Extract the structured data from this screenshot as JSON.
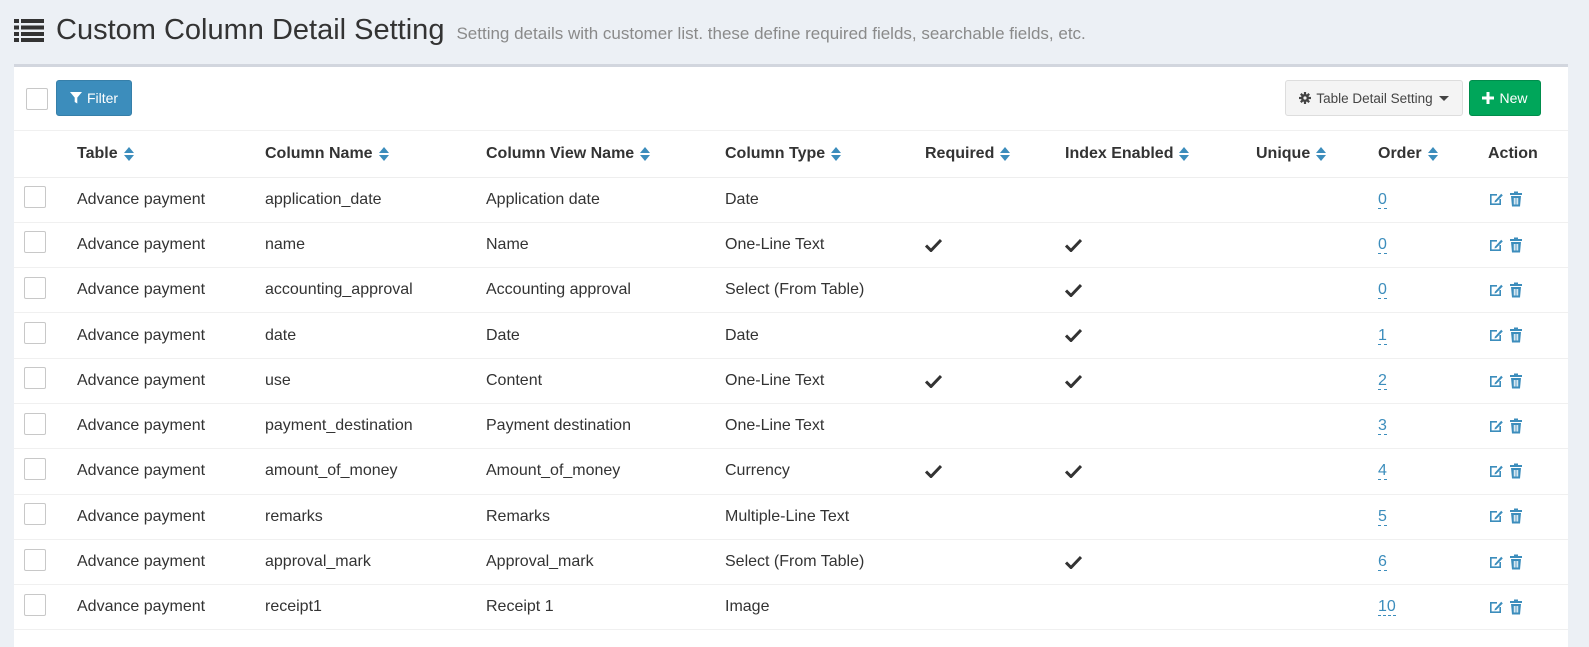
{
  "header": {
    "title": "Custom Column Detail Setting",
    "subtitle": "Setting details with customer list. these define required fields, searchable fields, etc."
  },
  "toolbar": {
    "filter_label": "Filter",
    "table_setting_label": "Table Detail Setting",
    "new_label": "New"
  },
  "columns": [
    "Table",
    "Column Name",
    "Column View Name",
    "Column Type",
    "Required",
    "Index Enabled",
    "Unique",
    "Order",
    "Action"
  ],
  "rows": [
    {
      "table": "Advance payment",
      "column_name": "application_date",
      "view_name": "Application date",
      "type": "Date",
      "required": false,
      "index": false,
      "unique": false,
      "order": "0"
    },
    {
      "table": "Advance payment",
      "column_name": "name",
      "view_name": "Name",
      "type": "One-Line Text",
      "required": true,
      "index": true,
      "unique": false,
      "order": "0"
    },
    {
      "table": "Advance payment",
      "column_name": "accounting_approval",
      "view_name": "Accounting approval",
      "type": "Select (From Table)",
      "required": false,
      "index": true,
      "unique": false,
      "order": "0"
    },
    {
      "table": "Advance payment",
      "column_name": "date",
      "view_name": "Date",
      "type": "Date",
      "required": false,
      "index": true,
      "unique": false,
      "order": "1"
    },
    {
      "table": "Advance payment",
      "column_name": "use",
      "view_name": "Content",
      "type": "One-Line Text",
      "required": true,
      "index": true,
      "unique": false,
      "order": "2"
    },
    {
      "table": "Advance payment",
      "column_name": "payment_destination",
      "view_name": "Payment destination",
      "type": "One-Line Text",
      "required": false,
      "index": false,
      "unique": false,
      "order": "3"
    },
    {
      "table": "Advance payment",
      "column_name": "amount_of_money",
      "view_name": "Amount_of_money",
      "type": "Currency",
      "required": true,
      "index": true,
      "unique": false,
      "order": "4"
    },
    {
      "table": "Advance payment",
      "column_name": "remarks",
      "view_name": "Remarks",
      "type": "Multiple-Line Text",
      "required": false,
      "index": false,
      "unique": false,
      "order": "5"
    },
    {
      "table": "Advance payment",
      "column_name": "approval_mark",
      "view_name": "Approval_mark",
      "type": "Select (From Table)",
      "required": false,
      "index": true,
      "unique": false,
      "order": "6"
    },
    {
      "table": "Advance payment",
      "column_name": "receipt1",
      "view_name": "Receipt 1",
      "type": "Image",
      "required": false,
      "index": false,
      "unique": false,
      "order": "10"
    }
  ],
  "colors": {
    "primary": "#3c8dbc",
    "success": "#00a65a",
    "background": "#ecf0f5"
  },
  "icons": {
    "header": "list-icon",
    "filter": "filter-icon",
    "setting": "gear-icon",
    "new": "plus-icon",
    "sort": "sort-icon",
    "check": "check-icon",
    "edit": "edit-icon",
    "delete": "trash-icon"
  }
}
